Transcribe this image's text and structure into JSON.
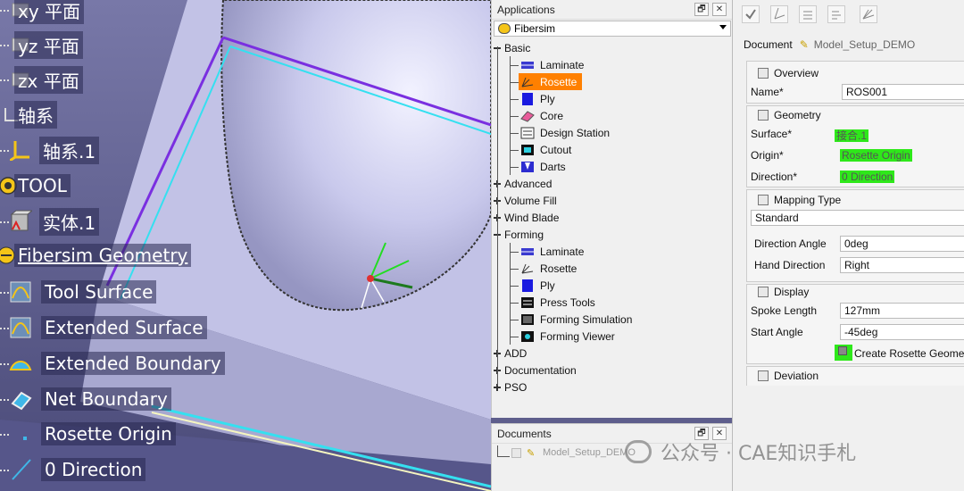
{
  "spec_tree": [
    {
      "label": "xy 平面",
      "icon": "plane-icon"
    },
    {
      "label": "yz 平面",
      "icon": "plane-icon"
    },
    {
      "label": "zx 平面",
      "icon": "plane-icon"
    },
    {
      "label": "轴系",
      "icon": "axis-system-group-icon"
    },
    {
      "label": "轴系.1",
      "icon": "axis-system-icon"
    },
    {
      "label": "TOOL",
      "icon": "gear-icon"
    },
    {
      "label": "实体.1",
      "icon": "solid-body-icon"
    },
    {
      "label": "Fibersim Geometry",
      "icon": "fibersim-geometry-icon"
    },
    {
      "label": "Tool Surface",
      "icon": "surface-icon"
    },
    {
      "label": "Extended Surface",
      "icon": "surface-icon"
    },
    {
      "label": "Extended Boundary",
      "icon": "boundary-icon"
    },
    {
      "label": "Net Boundary",
      "icon": "boundary-icon"
    },
    {
      "label": "Rosette Origin",
      "icon": "point-icon"
    },
    {
      "label": "0 Direction",
      "icon": "line-icon"
    }
  ],
  "applications_panel": {
    "title": "Applications",
    "restore_btn": "🗗",
    "close_btn": "✕",
    "selected_app": "Fibersim",
    "tree": [
      {
        "label": "Basic",
        "level": 0,
        "expanded": true
      },
      {
        "label": "Laminate",
        "level": 1,
        "icon": "laminate-icon"
      },
      {
        "label": "Rosette",
        "level": 1,
        "icon": "rosette-icon",
        "selected": true
      },
      {
        "label": "Ply",
        "level": 1,
        "icon": "ply-icon"
      },
      {
        "label": "Core",
        "level": 1,
        "icon": "core-icon"
      },
      {
        "label": "Design Station",
        "level": 1,
        "icon": "design-station-icon"
      },
      {
        "label": "Cutout",
        "level": 1,
        "icon": "cutout-icon"
      },
      {
        "label": "Darts",
        "level": 1,
        "icon": "darts-icon"
      },
      {
        "label": "Advanced",
        "level": 0,
        "expanded": false
      },
      {
        "label": "Volume Fill",
        "level": 0,
        "expanded": false
      },
      {
        "label": "Wind Blade",
        "level": 0,
        "expanded": false
      },
      {
        "label": "Forming",
        "level": 0,
        "expanded": true
      },
      {
        "label": "Laminate",
        "level": 1,
        "icon": "laminate-icon"
      },
      {
        "label": "Rosette",
        "level": 1,
        "icon": "rosette-icon"
      },
      {
        "label": "Ply",
        "level": 1,
        "icon": "ply-icon"
      },
      {
        "label": "Press Tools",
        "level": 1,
        "icon": "press-tools-icon"
      },
      {
        "label": "Forming Simulation",
        "level": 1,
        "icon": "forming-simulation-icon"
      },
      {
        "label": "Forming Viewer",
        "level": 1,
        "icon": "forming-viewer-icon"
      },
      {
        "label": "ADD",
        "level": 0,
        "expanded": false
      },
      {
        "label": "Documentation",
        "level": 0,
        "expanded": false
      },
      {
        "label": "PSO",
        "level": 0,
        "expanded": false
      }
    ]
  },
  "documents_panel": {
    "title": "Documents",
    "restore_btn": "🗗",
    "close_btn": "✕",
    "item": "Model_Setup_DEMO"
  },
  "properties": {
    "document_label": "Document",
    "document_name": "Model_Setup_DEMO",
    "overview": {
      "title": "Overview",
      "name_label": "Name*",
      "name_value": "ROS001"
    },
    "geometry": {
      "title": "Geometry",
      "surface_label": "Surface*",
      "surface_value": "接合.1",
      "origin_label": "Origin*",
      "origin_value": "Rosette Origin",
      "direction_label": "Direction*",
      "direction_value": "0 Direction"
    },
    "mapping": {
      "title": "Mapping Type",
      "type_value": "Standard",
      "angle_label": "Direction Angle",
      "angle_value": "0deg",
      "hand_label": "Hand Direction",
      "hand_value": "Right"
    },
    "display": {
      "title": "Display",
      "spoke_label": "Spoke Length",
      "spoke_value": "127mm",
      "start_label": "Start Angle",
      "start_value": "-45deg",
      "create_label": "Create Rosette Geometry"
    },
    "deviation": {
      "title": "Deviation"
    }
  },
  "watermark": "公众号 · CAE知识手札",
  "colors": {
    "selection": "#ff8000",
    "highlight": "#2ee81a",
    "viewport_bg": "#5e5e8c",
    "surface": "#c8c8ea",
    "purple_edge": "#7a2fe0",
    "cyan_edge": "#35e0f0"
  }
}
